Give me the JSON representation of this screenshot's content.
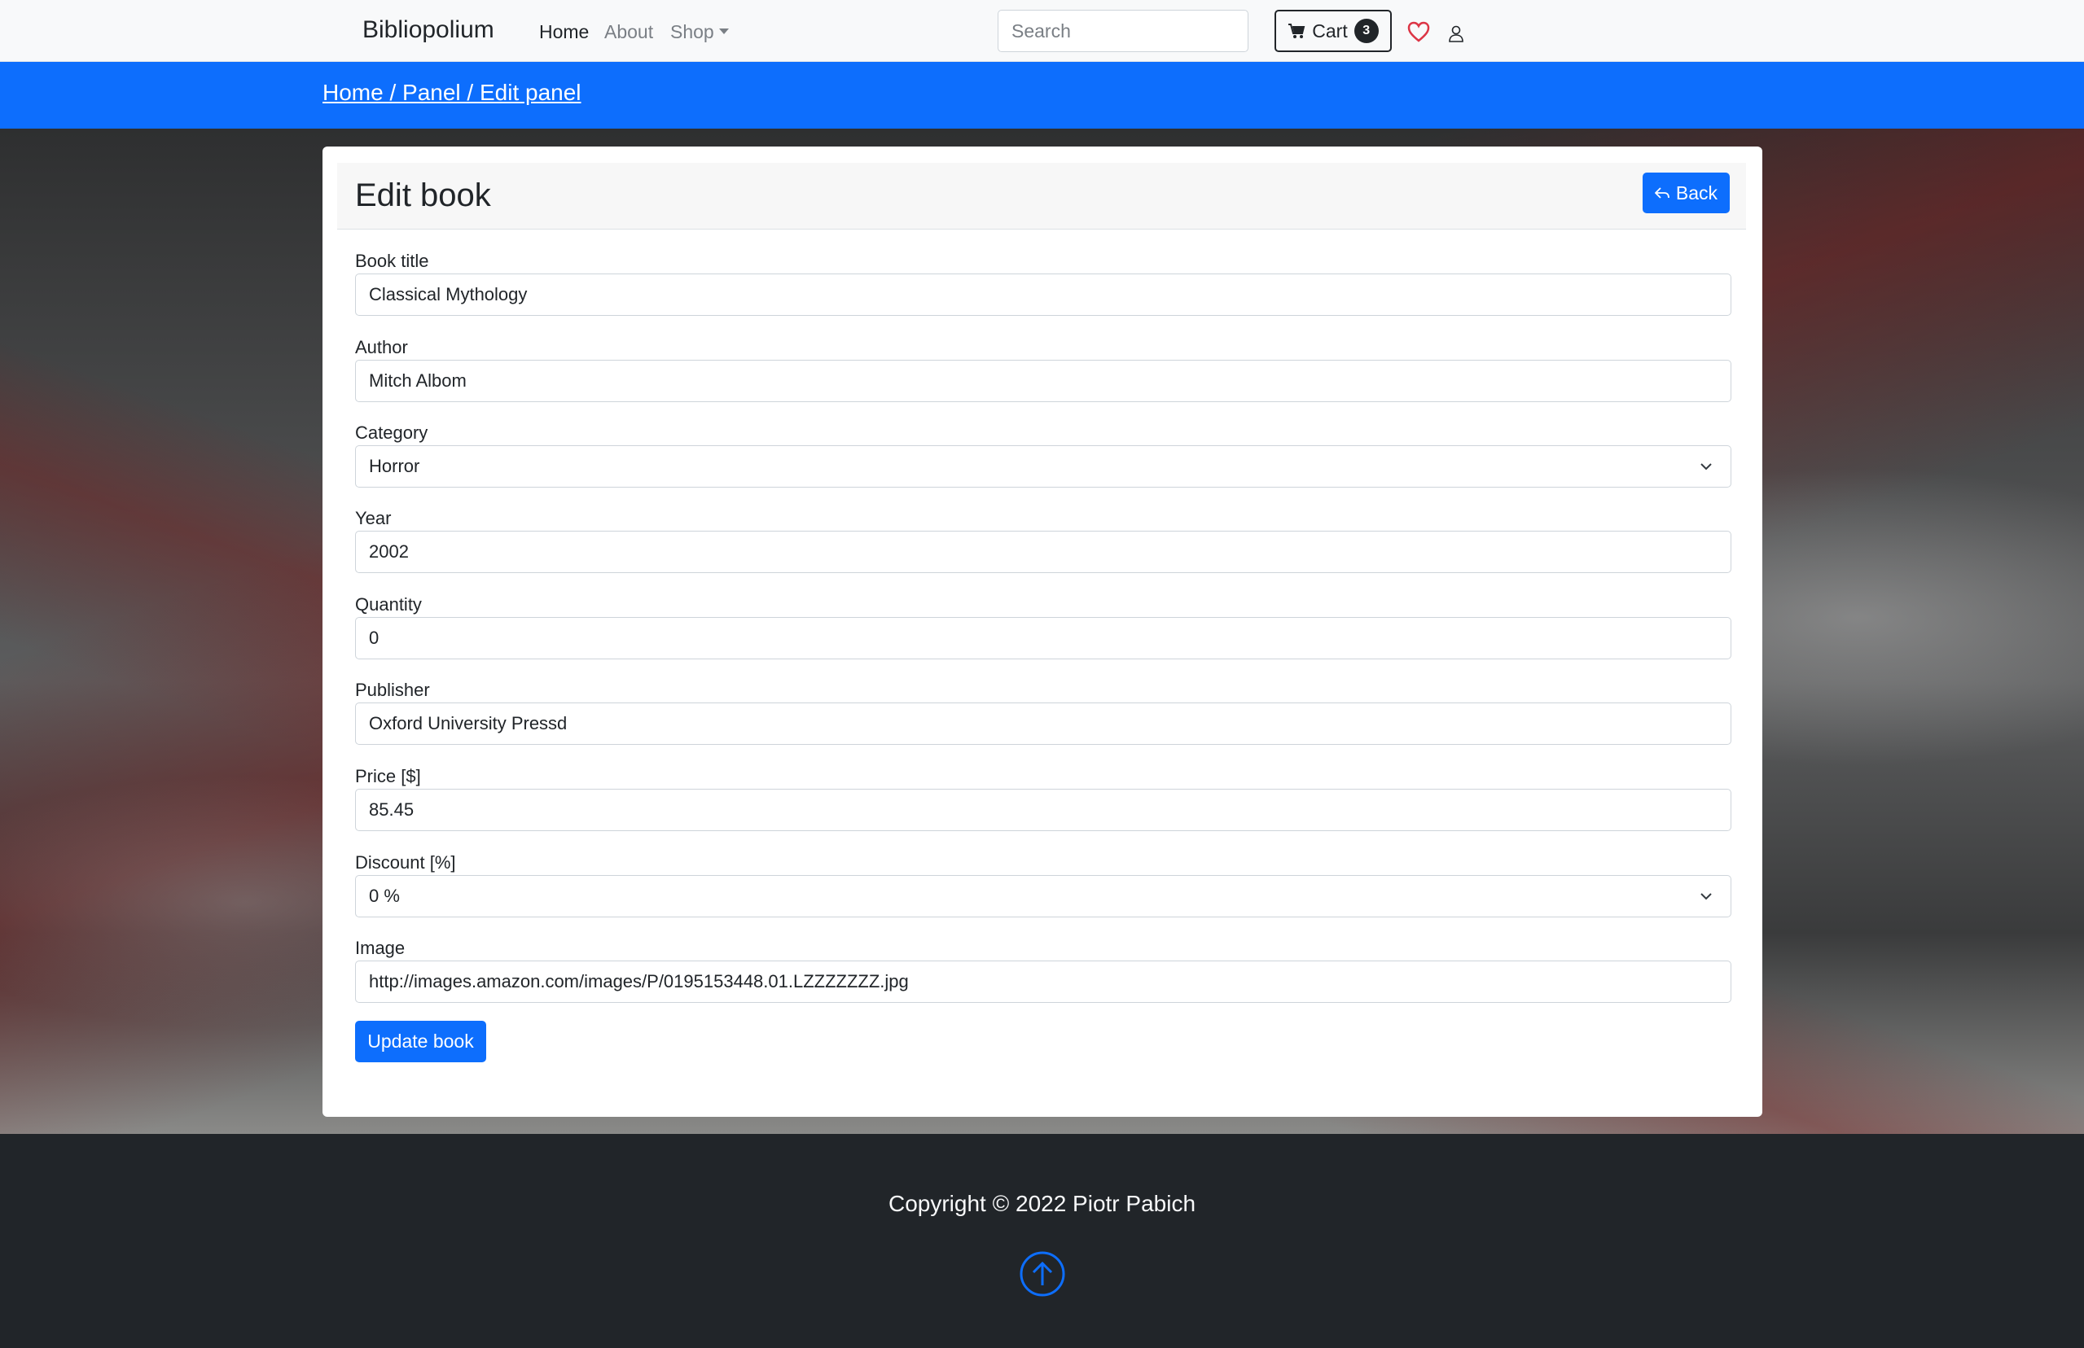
{
  "navbar": {
    "brand": "Bibliopolium",
    "links": [
      {
        "label": "Home",
        "active": true
      },
      {
        "label": "About",
        "active": false
      },
      {
        "label": "Shop",
        "active": false
      }
    ],
    "search_placeholder": "Search",
    "cart_label": "Cart",
    "cart_count": "3",
    "icons": [
      "cart-icon",
      "heart-icon",
      "user-icon"
    ]
  },
  "breadcrumb": "Home / Panel / Edit panel",
  "card": {
    "title": "Edit book",
    "back_label": "Back",
    "fields": {
      "title": {
        "label": "Book title",
        "value": "Classical Mythology"
      },
      "author": {
        "label": "Author",
        "value": "Mitch Albom"
      },
      "category": {
        "label": "Category",
        "value": "Horror"
      },
      "year": {
        "label": "Year",
        "value": "2002"
      },
      "quantity": {
        "label": "Quantity",
        "value": "0"
      },
      "publisher": {
        "label": "Publisher",
        "value": "Oxford University Pressd"
      },
      "price": {
        "label": "Price [$]",
        "value": "85.45"
      },
      "discount": {
        "label": "Discount [%]",
        "value": "0 %"
      },
      "image": {
        "label": "Image",
        "value": "http://images.amazon.com/images/P/0195153448.01.LZZZZZZZ.jpg"
      }
    },
    "submit_label": "Update book"
  },
  "footer": {
    "copyright": "Copyright © 2022 Piotr Pabich"
  },
  "colors": {
    "primary": "#0d6efd",
    "dark": "#212529",
    "heart": "#dc3545"
  }
}
